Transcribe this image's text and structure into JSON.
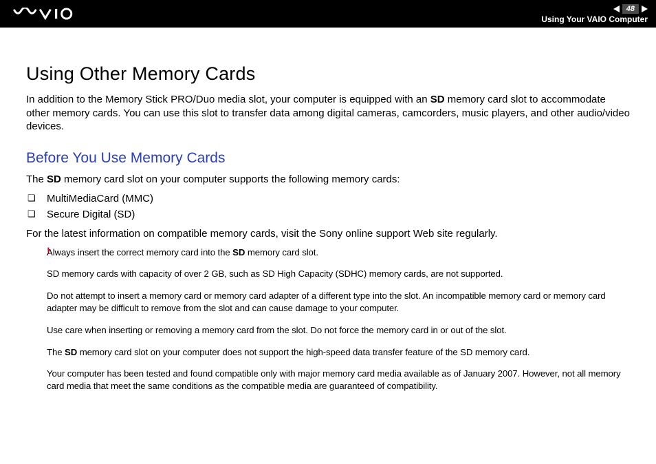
{
  "header": {
    "page_number": "48",
    "breadcrumb": "Using Your VAIO Computer"
  },
  "title": "Using Other Memory Cards",
  "intro_pre": "In addition to the Memory Stick PRO/Duo media slot, your computer is equipped with an ",
  "intro_bold": "SD",
  "intro_post": " memory card slot to accommodate other memory cards. You can use this slot to transfer data among digital cameras, camcorders, music players, and other audio/video devices.",
  "subheading": "Before You Use Memory Cards",
  "supports_pre": "The ",
  "supports_bold": "SD",
  "supports_post": " memory card slot on your computer supports the following memory cards:",
  "bullets": {
    "b0": "MultiMediaCard (MMC)",
    "b1": "Secure Digital (SD)"
  },
  "latest_info": "For the latest information on compatible memory cards, visit the Sony online support Web site regularly.",
  "warn_mark": "!",
  "warnings": {
    "w0_pre": "Always insert the correct memory card into the ",
    "w0_bold": "SD",
    "w0_post": " memory card slot.",
    "w1": "SD memory cards with capacity of over 2 GB, such as SD High Capacity (SDHC) memory cards, are not supported.",
    "w2": "Do not attempt to insert a memory card or memory card adapter of a different type into the slot. An incompatible memory card or memory card adapter may be difficult to remove from the slot and can cause damage to your computer.",
    "w3": "Use care when inserting or removing a memory card from the slot. Do not force the memory card in or out of the slot.",
    "w4_pre": "The ",
    "w4_bold": "SD",
    "w4_post": " memory card slot on your computer does not support the high-speed data transfer feature of the SD memory card.",
    "w5": "Your computer has been tested and found compatible only with major memory card media available as of January 2007. However, not all memory card media that meet the same conditions as the compatible media are guaranteed of compatibility."
  }
}
